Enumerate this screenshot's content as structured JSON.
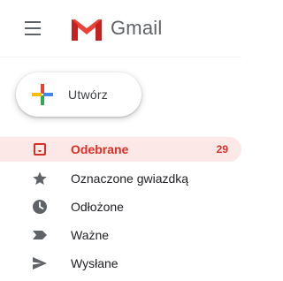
{
  "header": {
    "app_name": "Gmail",
    "menu_icon": "hamburger-menu-icon",
    "logo_icon": "gmail-m-logo"
  },
  "compose": {
    "label": "Utwórz",
    "icon": "colorful-plus-icon"
  },
  "nav": {
    "items": [
      {
        "label": "Odebrane",
        "count": "29",
        "icon": "inbox-icon",
        "active": true
      },
      {
        "label": "Oznaczone gwiazdką",
        "count": "",
        "icon": "star-icon",
        "active": false
      },
      {
        "label": "Odłożone",
        "count": "",
        "icon": "clock-icon",
        "active": false
      },
      {
        "label": "Ważne",
        "count": "",
        "icon": "important-label-icon",
        "active": false
      },
      {
        "label": "Wysłane",
        "count": "",
        "icon": "send-icon",
        "active": false
      }
    ]
  },
  "colors": {
    "active_text": "#d93025",
    "active_bg": "#fce8e6",
    "icon_gray": "#5f6368",
    "text": "#202124"
  }
}
